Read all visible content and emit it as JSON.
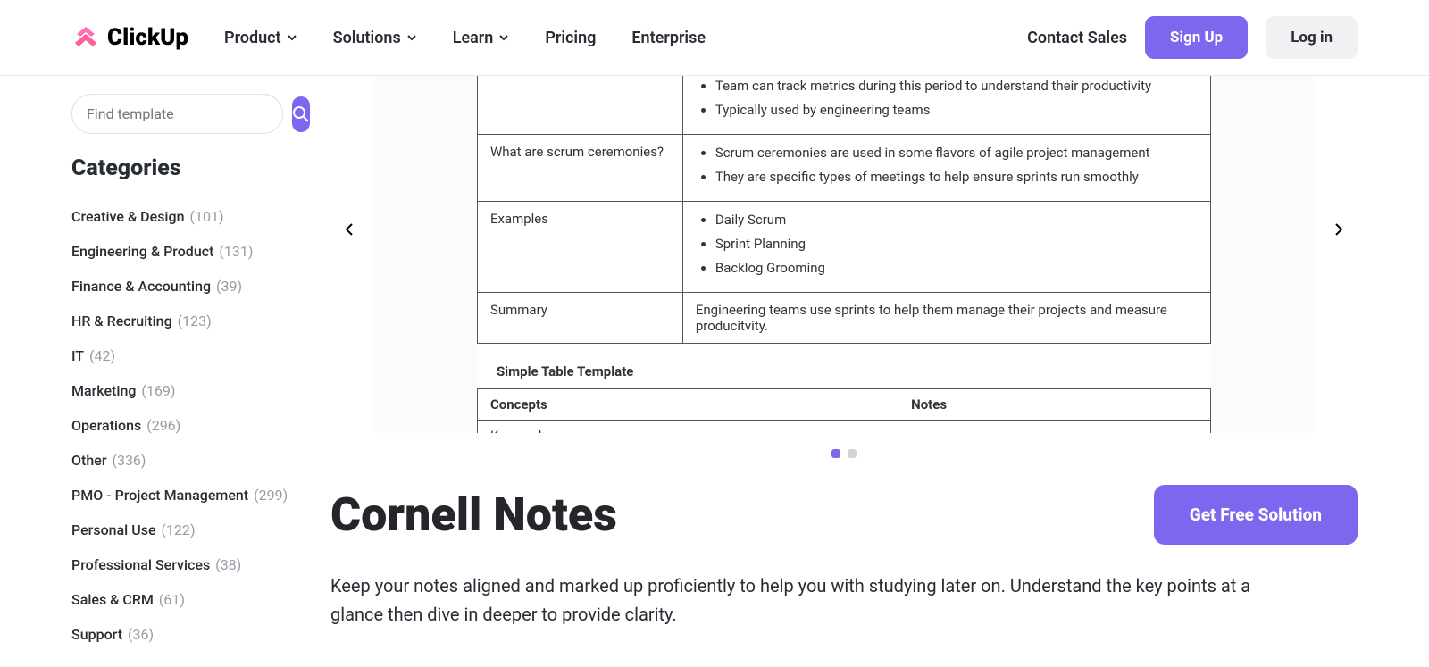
{
  "header": {
    "brand": "ClickUp",
    "nav": [
      {
        "label": "Product",
        "dropdown": true
      },
      {
        "label": "Solutions",
        "dropdown": true
      },
      {
        "label": "Learn",
        "dropdown": true
      },
      {
        "label": "Pricing",
        "dropdown": false
      },
      {
        "label": "Enterprise",
        "dropdown": false
      }
    ],
    "contact": "Contact Sales",
    "signup": "Sign Up",
    "login": "Log in"
  },
  "sidebar": {
    "search_placeholder": "Find template",
    "categories_title": "Categories",
    "categories": [
      {
        "name": "Creative & Design",
        "count": "(101)"
      },
      {
        "name": "Engineering & Product",
        "count": "(131)"
      },
      {
        "name": "Finance & Accounting",
        "count": "(39)"
      },
      {
        "name": "HR & Recruiting",
        "count": "(123)"
      },
      {
        "name": "IT",
        "count": "(42)"
      },
      {
        "name": "Marketing",
        "count": "(169)"
      },
      {
        "name": "Operations",
        "count": "(296)"
      },
      {
        "name": "Other",
        "count": "(336)"
      },
      {
        "name": "PMO - Project Management",
        "count": "(299)"
      },
      {
        "name": "Personal Use",
        "count": "(122)"
      },
      {
        "name": "Professional Services",
        "count": "(38)"
      },
      {
        "name": "Sales & CRM",
        "count": "(61)"
      },
      {
        "name": "Support",
        "count": "(36)"
      }
    ]
  },
  "preview": {
    "rows": [
      {
        "q": "",
        "notes": [
          "Team can track metrics during this period to understand their productivity",
          "Typically used by engineering teams"
        ]
      },
      {
        "q": "What are scrum ceremonies?",
        "notes": [
          "Scrum ceremonies are used in some flavors of agile project management",
          "They are specific types of meetings to help ensure sprints run smoothly"
        ]
      },
      {
        "q": "Examples",
        "notes": [
          "Daily Scrum",
          "Sprint Planning",
          "Backlog Grooming"
        ]
      },
      {
        "q": "Summary",
        "summary": "Engineering teams use sprints to help them manage their projects and measure producitvity."
      }
    ],
    "simple_title": "Simple Table Template",
    "simple_headers": [
      "Concepts",
      "Notes"
    ],
    "simple_row": [
      "Keyword",
      "…"
    ]
  },
  "page": {
    "title": "Cornell Notes",
    "cta": "Get Free Solution",
    "description": "Keep your notes aligned and marked up proficiently to help you with studying later on. Understand the key points at a glance then dive in deeper to provide clarity."
  }
}
